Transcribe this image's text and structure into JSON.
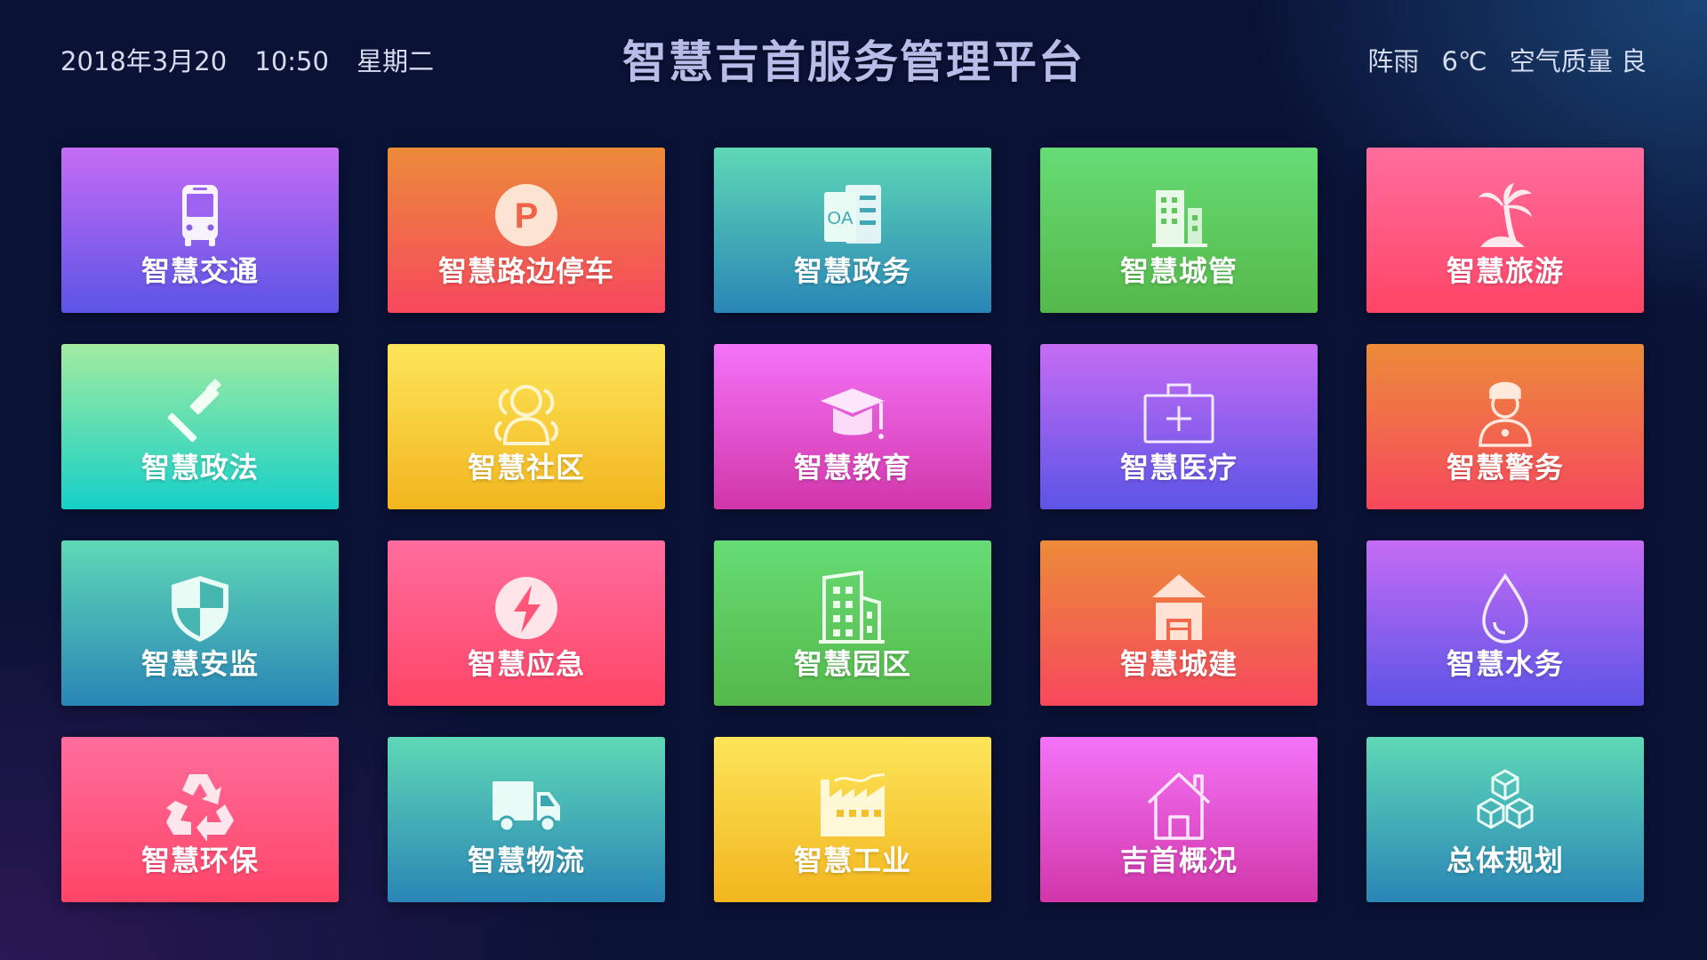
{
  "header": {
    "date": "2018年3月20",
    "time": "10:50",
    "weekday": "星期二",
    "title": "智慧吉首服务管理平台",
    "weather": "阵雨",
    "temperature": "6℃",
    "air_quality": "空气质量 良"
  },
  "tiles": [
    {
      "label": "智慧交通",
      "icon": "bus-icon",
      "color": "purple"
    },
    {
      "label": "智慧路边停车",
      "icon": "parking-icon",
      "color": "orange"
    },
    {
      "label": "智慧政务",
      "icon": "oa-document-icon",
      "color": "teal"
    },
    {
      "label": "智慧城管",
      "icon": "city-building-icon",
      "color": "green"
    },
    {
      "label": "智慧旅游",
      "icon": "palm-tree-icon",
      "color": "pink"
    },
    {
      "label": "智慧政法",
      "icon": "gavel-icon",
      "color": "mint"
    },
    {
      "label": "智慧社区",
      "icon": "community-people-icon",
      "color": "yellow"
    },
    {
      "label": "智慧教育",
      "icon": "graduation-cap-icon",
      "color": "magenta"
    },
    {
      "label": "智慧医疗",
      "icon": "medical-kit-icon",
      "color": "purple"
    },
    {
      "label": "智慧警务",
      "icon": "police-officer-icon",
      "color": "orange"
    },
    {
      "label": "智慧安监",
      "icon": "shield-icon",
      "color": "teal"
    },
    {
      "label": "智慧应急",
      "icon": "lightning-icon",
      "color": "pink"
    },
    {
      "label": "智慧园区",
      "icon": "office-park-icon",
      "color": "green"
    },
    {
      "label": "智慧城建",
      "icon": "house-construction-icon",
      "color": "orange"
    },
    {
      "label": "智慧水务",
      "icon": "water-drop-icon",
      "color": "purple"
    },
    {
      "label": "智慧环保",
      "icon": "recycle-icon",
      "color": "pink"
    },
    {
      "label": "智慧物流",
      "icon": "delivery-truck-icon",
      "color": "teal"
    },
    {
      "label": "智慧工业",
      "icon": "factory-icon",
      "color": "yellow"
    },
    {
      "label": "吉首概况",
      "icon": "home-outline-icon",
      "color": "magenta"
    },
    {
      "label": "总体规划",
      "icon": "cubes-icon",
      "color": "teal"
    }
  ]
}
